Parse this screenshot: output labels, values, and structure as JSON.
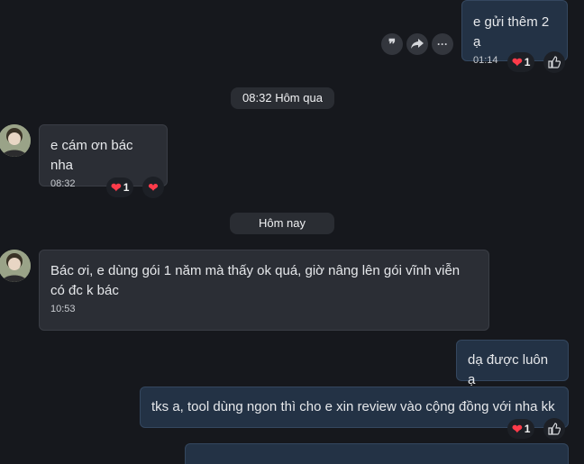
{
  "messages": {
    "m1": {
      "text": "e gửi thêm 2 ạ",
      "time": "01:14",
      "reaction_count": "1"
    },
    "m2": {
      "text": "e cám ơn bác nha",
      "time": "08:32",
      "reaction_count": "1"
    },
    "m3": {
      "text": "Bác ơi, e dùng gói 1 năm mà thấy ok quá, giờ nâng lên gói vĩnh viễn có đc k bác",
      "time": "10:53"
    },
    "m4": {
      "text": "dạ được luôn ạ"
    },
    "m5": {
      "text": "tks a, tool dùng ngon thì cho e xin review vào cộng đồng với nha kk",
      "reaction_count": "1"
    }
  },
  "dividers": {
    "yesterday": "08:32 Hôm qua",
    "today": "Hôm nay"
  },
  "icons": {
    "reaction": "heart-icon",
    "like": "thumbs-up-icon",
    "quote": "quote-icon",
    "forward": "forward-icon",
    "more": "more-icon"
  },
  "colors": {
    "background": "#16181d",
    "incoming": "#2b2e35",
    "outgoing": "#233245",
    "heart": "#ff3b4a"
  }
}
